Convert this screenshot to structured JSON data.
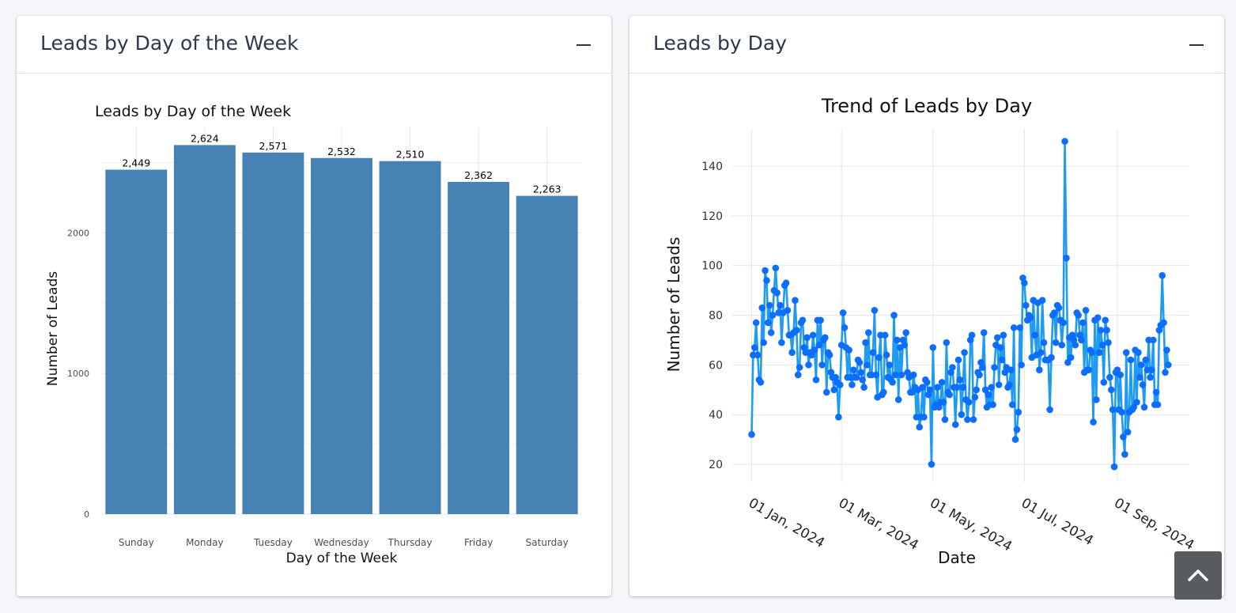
{
  "cards": [
    {
      "title": "Leads by Day of the Week",
      "collapse_icon": "minus-icon"
    },
    {
      "title": "Leads by Day",
      "collapse_icon": "minus-icon"
    }
  ],
  "chart_data": [
    {
      "type": "bar",
      "title": "Leads by Day of the Week",
      "xlabel": "Day of the Week",
      "ylabel": "Number of Leads",
      "categories": [
        "Sunday",
        "Monday",
        "Tuesday",
        "Wednesday",
        "Thursday",
        "Friday",
        "Saturday"
      ],
      "values": [
        2449,
        2624,
        2571,
        2532,
        2510,
        2362,
        2263
      ],
      "value_labels": [
        "2,449",
        "2,624",
        "2,571",
        "2,532",
        "2,510",
        "2,362",
        "2,263"
      ],
      "yticks": [
        0,
        1000,
        2000
      ],
      "ylim": [
        0,
        2750
      ],
      "color": "#4682b4",
      "grid": true
    },
    {
      "type": "line",
      "title": "Trend of Leads by Day",
      "xlabel": "Date",
      "ylabel": "Number of Leads",
      "x_start": "2024-01-01",
      "x_end": "2024-09-30",
      "xticks": [
        "2024-01-01",
        "2024-03-01",
        "2024-05-01",
        "2024-07-01",
        "2024-09-01"
      ],
      "xtick_labels": [
        "01 Jan, 2024",
        "01 Mar, 2024",
        "01 May, 2024",
        "01 Jul, 2024",
        "01 Sep, 2024"
      ],
      "yticks": [
        20,
        40,
        60,
        80,
        100,
        120,
        140
      ],
      "ylim": [
        13,
        155
      ],
      "line_color": "#1f9bf0",
      "marker_color": "#0d6efd",
      "grid": true,
      "y": [
        32,
        64,
        67,
        77,
        64,
        54,
        53,
        83,
        69,
        98,
        94,
        77,
        84,
        73,
        80,
        90,
        99,
        89,
        81,
        84,
        69,
        81,
        92,
        93,
        82,
        72,
        72,
        65,
        73,
        86,
        74,
        56,
        59,
        77,
        78,
        67,
        65,
        71,
        60,
        65,
        64,
        72,
        66,
        54,
        78,
        68,
        78,
        60,
        70,
        71,
        49,
        65,
        64,
        57,
        55,
        50,
        55,
        53,
        39,
        52,
        68,
        81,
        75,
        67,
        55,
        66,
        55,
        52,
        58,
        55,
        55,
        62,
        61,
        57,
        54,
        51,
        69,
        60,
        73,
        56,
        56,
        65,
        82,
        56,
        47,
        63,
        72,
        48,
        49,
        72,
        64,
        55,
        60,
        54,
        53,
        80,
        56,
        70,
        46,
        67,
        56,
        70,
        68,
        73,
        57,
        55,
        49,
        49,
        56,
        51,
        39,
        50,
        35,
        39,
        51,
        39,
        54,
        53,
        48,
        50,
        20,
        67,
        43,
        44,
        51,
        43,
        45,
        53,
        45,
        38,
        69,
        49,
        48,
        57,
        59,
        51,
        36,
        51,
        62,
        54,
        40,
        51,
        65,
        46,
        38,
        45,
        70,
        72,
        38,
        47,
        50,
        57,
        56,
        61,
        59,
        73,
        50,
        43,
        48,
        44,
        51,
        44,
        59,
        68,
        71,
        52,
        67,
        62,
        72,
        57,
        59,
        51,
        52,
        58,
        44,
        75,
        30,
        34,
        41,
        75,
        60,
        95,
        93,
        84,
        78,
        80,
        79,
        63,
        86,
        72,
        64,
        85,
        58,
        65,
        86,
        69,
        62,
        62,
        62,
        42,
        63,
        80,
        81,
        69,
        84,
        83,
        78,
        68,
        77,
        150,
        103,
        61,
        71,
        63,
        72,
        70,
        68,
        81,
        80,
        72,
        70,
        77,
        57,
        82,
        58,
        58,
        66,
        65,
        37,
        78,
        46,
        79,
        65,
        74,
        68,
        53,
        78,
        74,
        69,
        55,
        50,
        42,
        19,
        57,
        58,
        42,
        56,
        41,
        31,
        24,
        65,
        33,
        41,
        62,
        42,
        43,
        66,
        45,
        65,
        55,
        60,
        52,
        43,
        62,
        58,
        70,
        55,
        58,
        70,
        44,
        49,
        44,
        74,
        76,
        96,
        77,
        57,
        66,
        60
      ]
    }
  ]
}
